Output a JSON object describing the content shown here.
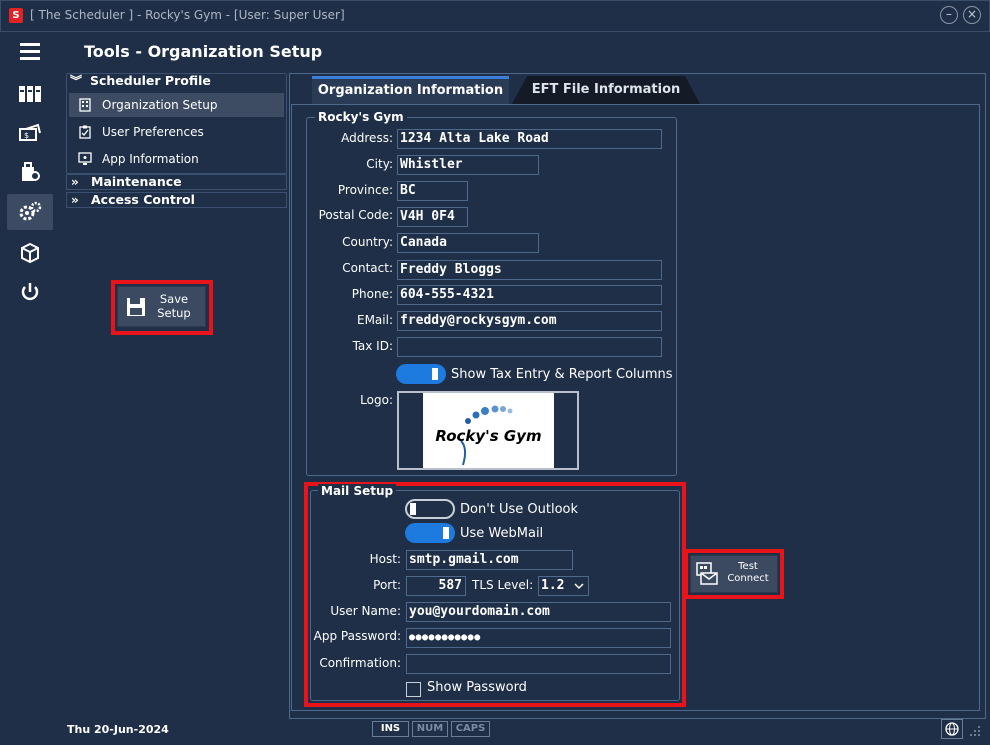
{
  "window": {
    "title": "[ The Scheduler ] - Rocky's Gym - [User: Super User]",
    "minimize_icon": "minimize-icon",
    "close_icon": "close-icon"
  },
  "header": {
    "title": "Tools - Organization Setup"
  },
  "nav": {
    "scheduler_profile": "Scheduler Profile",
    "items": [
      {
        "label": "Organization Setup",
        "selected": true,
        "icon": "building-icon"
      },
      {
        "label": "User Preferences",
        "selected": false,
        "icon": "clipboard-icon"
      },
      {
        "label": "App Information",
        "selected": false,
        "icon": "monitor-icon"
      }
    ],
    "maintenance": "Maintenance",
    "access_control": "Access Control"
  },
  "save_button": {
    "line1": "Save",
    "line2": "Setup"
  },
  "tabs": {
    "org_info": "Organization Information",
    "eft": "EFT File Information"
  },
  "org": {
    "group_title": "Rocky's Gym",
    "address_label": "Address:",
    "address": "1234 Alta Lake Road",
    "city_label": "City:",
    "city": "Whistler",
    "province_label": "Province:",
    "province": "BC",
    "postal_label": "Postal Code:",
    "postal": "V4H 0F4",
    "country_label": "Country:",
    "country": "Canada",
    "contact_label": "Contact:",
    "contact": "Freddy Bloggs",
    "phone_label": "Phone:",
    "phone": "604-555-4321",
    "email_label": "EMail:",
    "email": "freddy@rockysgym.com",
    "taxid_label": "Tax ID:",
    "taxid": "",
    "show_tax_label": "Show Tax Entry & Report Columns",
    "show_tax_on": true,
    "logo_label": "Logo:",
    "logo_text": "Rocky's Gym"
  },
  "mail": {
    "group_title": "Mail Setup",
    "dont_use_outlook": "Don't Use Outlook",
    "dont_use_outlook_on": false,
    "use_webmail": "Use WebMail",
    "use_webmail_on": true,
    "host_label": "Host:",
    "host": "smtp.gmail.com",
    "port_label": "Port:",
    "port": "587",
    "tls_label": "TLS Level:",
    "tls": "1.2",
    "username_label": "User Name:",
    "username": "you@yourdomain.com",
    "app_password_label": "App Password:",
    "app_password": "●●●●●●●●●●●",
    "confirmation_label": "Confirmation:",
    "confirmation": "",
    "show_password": "Show Password",
    "show_password_checked": false
  },
  "test_connect": {
    "line1": "Test",
    "line2": "Connect"
  },
  "status": {
    "date": "Thu  20-Jun-2024",
    "ins": "INS",
    "num": "NUM",
    "caps": "CAPS"
  },
  "colors": {
    "background": "#1e2f47",
    "accent": "#1d7be0",
    "highlight": "#e8141a"
  }
}
